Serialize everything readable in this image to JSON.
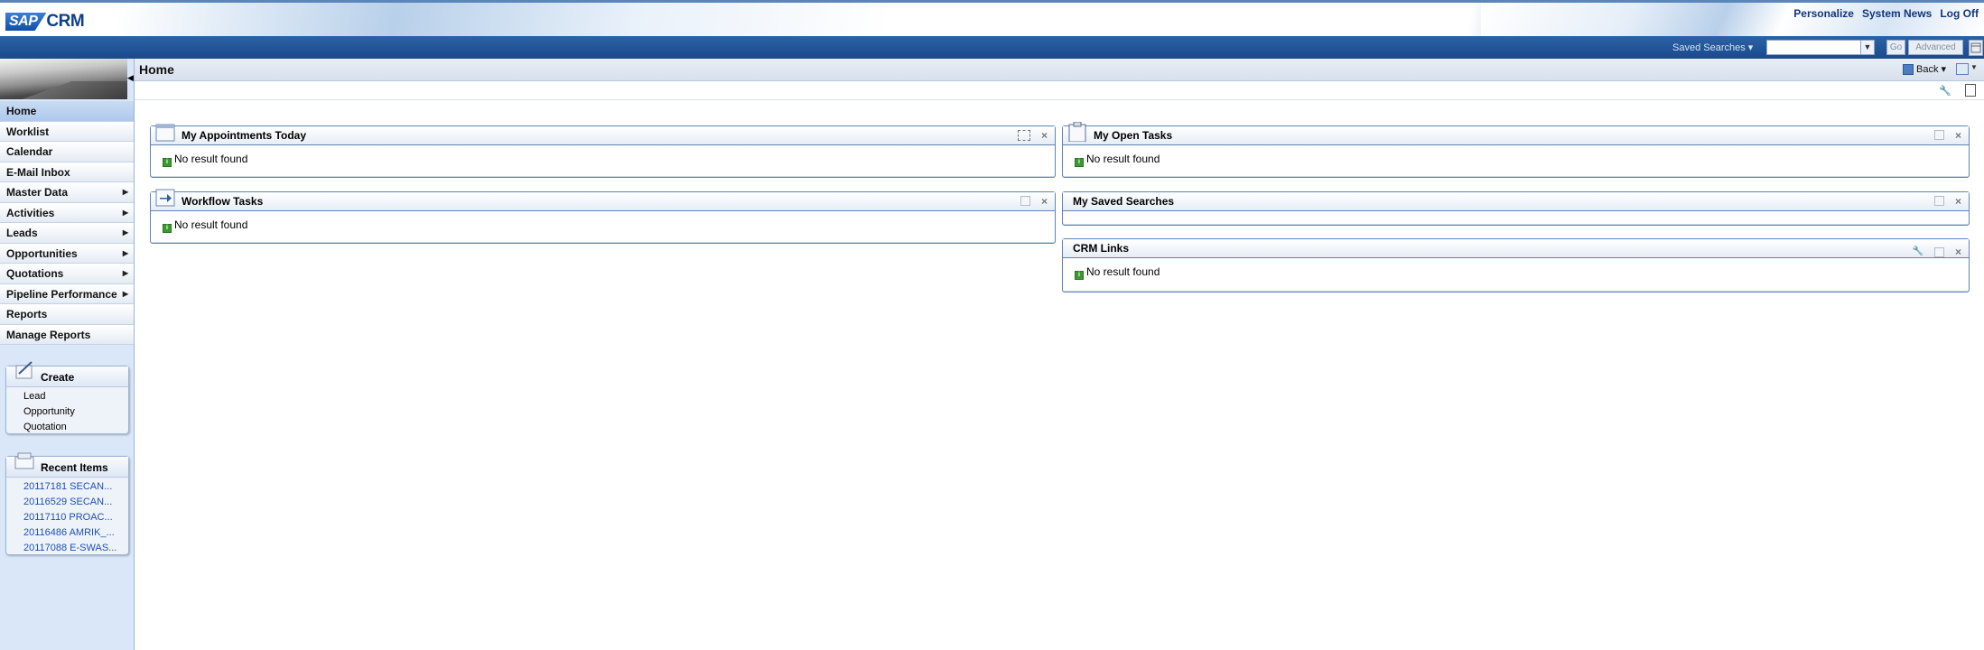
{
  "header": {
    "logo_sap": "SAP",
    "logo_crm": "CRM",
    "links": [
      "Personalize",
      "System News",
      "Log Off"
    ]
  },
  "searchbar": {
    "label": "Saved Searches ▾",
    "input_value": "",
    "go_label": "Go",
    "advanced_label": "Advanced"
  },
  "page": {
    "title": "Home",
    "back_label": "Back ▾"
  },
  "nav": {
    "items": [
      {
        "label": "Home",
        "submenu": false,
        "active": true
      },
      {
        "label": "Worklist",
        "submenu": false,
        "active": false
      },
      {
        "label": "Calendar",
        "submenu": false,
        "active": false
      },
      {
        "label": "E-Mail Inbox",
        "submenu": false,
        "active": false
      },
      {
        "label": "Master Data",
        "submenu": true,
        "active": false
      },
      {
        "label": "Activities",
        "submenu": true,
        "active": false
      },
      {
        "label": "Leads",
        "submenu": true,
        "active": false
      },
      {
        "label": "Opportunities",
        "submenu": true,
        "active": false
      },
      {
        "label": "Quotations",
        "submenu": true,
        "active": false
      },
      {
        "label": "Pipeline Performance",
        "submenu": true,
        "active": false
      },
      {
        "label": "Reports",
        "submenu": false,
        "active": false
      },
      {
        "label": "Manage Reports",
        "submenu": false,
        "active": false
      }
    ]
  },
  "create": {
    "title": "Create",
    "items": [
      "Lead",
      "Opportunity",
      "Quotation"
    ]
  },
  "recent": {
    "title": "Recent Items",
    "items": [
      "20117181 SECAN...",
      "20116529 SECAN...",
      "20117110 PROAC...",
      "20116486 AMRIK_...",
      "20117088 E-SWAS..."
    ]
  },
  "panels": {
    "appointments": {
      "title": "My Appointments Today",
      "message": "No result found"
    },
    "workflow": {
      "title": "Workflow Tasks",
      "message": "No result found"
    },
    "open_tasks": {
      "title": "My Open Tasks",
      "message": "No result found"
    },
    "saved_searches": {
      "title": "My Saved Searches"
    },
    "crm_links": {
      "title": "CRM Links",
      "message": "No result found"
    }
  },
  "colors": {
    "brand_blue": "#1a4a8d",
    "nav_bg": "#dae7f8",
    "panel_border": "#5f84b6",
    "link_blue": "#1f4fb3",
    "ok_green": "#3b9a2f"
  }
}
